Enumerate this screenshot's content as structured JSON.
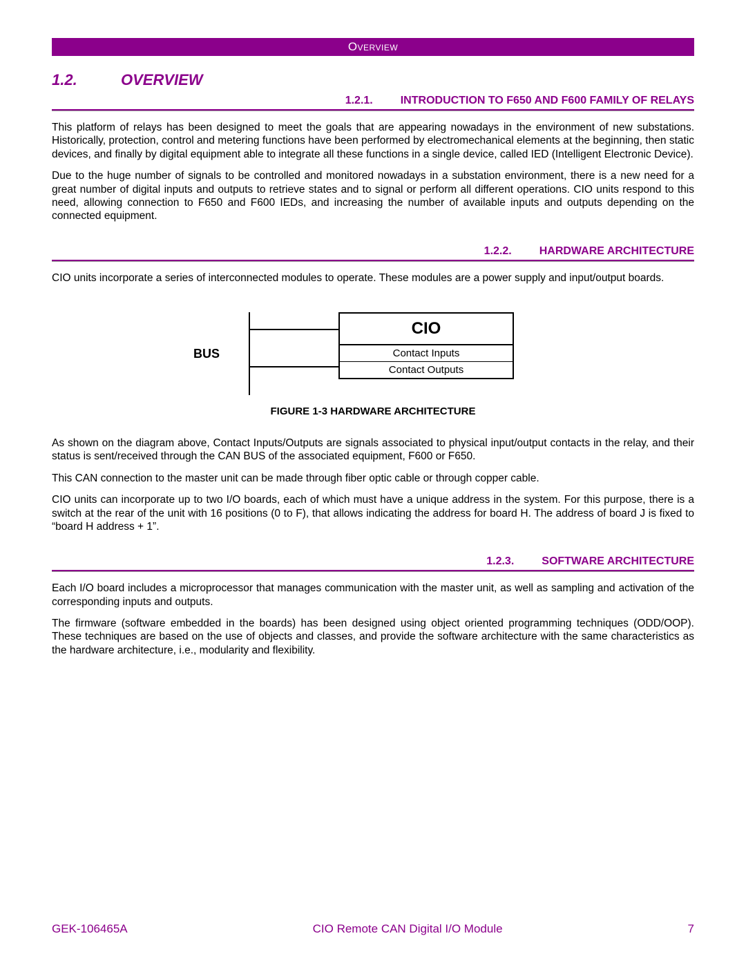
{
  "header": {
    "title": "Overview"
  },
  "section": {
    "num": "1.2.",
    "title": "OVERVIEW"
  },
  "sub1": {
    "num": "1.2.1.",
    "title": "INTRODUCTION TO F650 AND F600 FAMILY OF RELAYS",
    "p1": "This platform of relays has been designed to meet the goals that are appearing nowadays in the environment of new substations. Historically, protection, control and metering functions have been performed by electromechanical elements at the beginning, then static devices, and finally by digital equipment able to integrate all these functions in a single device, called IED (Intelligent Electronic Device).",
    "p2": "Due to the huge number of signals to be controlled and monitored nowadays in a substation environment, there is a new need for a great number of digital inputs and outputs to retrieve states and to signal or perform all different operations. CIO units respond to this need, allowing connection to F650 and F600 IEDs, and increasing the number of available inputs and outputs depending on the connected equipment."
  },
  "sub2": {
    "num": "1.2.2.",
    "title": "HARDWARE ARCHITECTURE",
    "p1": "CIO units incorporate a series of interconnected modules to operate. These modules are a power supply and input/output boards.",
    "p2": "As shown on the diagram above, Contact Inputs/Outputs are signals associated to physical input/output contacts in the relay, and their status is sent/received through the CAN BUS of the associated equipment, F600 or F650.",
    "p3": "This CAN connection to the master unit can be made through fiber optic cable or through copper cable.",
    "p4": "CIO units can incorporate up to two I/O boards, each of which must have a unique address in the system. For this purpose, there is a switch at the rear of the unit with 16 positions (0 to F), that allows indicating the address for board H. The address of board J is fixed to “board H address + 1”."
  },
  "figure": {
    "bus": "BUS",
    "cio": "CIO",
    "row1": "Contact Inputs",
    "row2": "Contact Outputs",
    "caption": "FIGURE 1-3 HARDWARE ARCHITECTURE"
  },
  "sub3": {
    "num": "1.2.3.",
    "title": "SOFTWARE ARCHITECTURE",
    "p1": "Each I/O board includes a microprocessor that manages communication with the master unit, as well as sampling and activation of the corresponding inputs and outputs.",
    "p2": "The firmware (software embedded in the boards) has been designed using object oriented programming techniques (ODD/OOP). These techniques are based on the use of objects and classes, and provide the software architecture with the same characteristics as the hardware architecture, i.e., modularity and flexibility."
  },
  "footer": {
    "left": "GEK-106465A",
    "center": "CIO Remote CAN Digital I/O Module",
    "right": "7"
  }
}
